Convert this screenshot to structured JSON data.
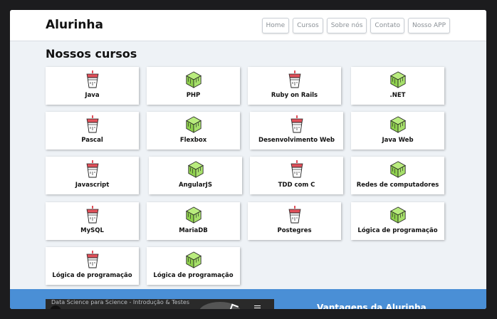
{
  "header": {
    "brand": "Alurinha",
    "nav": [
      {
        "label": "Home",
        "name": "nav-home"
      },
      {
        "label": "Cursos",
        "name": "nav-cursos"
      },
      {
        "label": "Sobre nós",
        "name": "nav-sobre-nos"
      },
      {
        "label": "Contato",
        "name": "nav-contato"
      },
      {
        "label": "Nosso APP",
        "name": "nav-nosso-app"
      }
    ]
  },
  "main": {
    "title": "Nossos cursos",
    "courses": [
      {
        "label": "Java",
        "icon": "coffee-cup-icon"
      },
      {
        "label": "PHP",
        "icon": "green-cube-icon"
      },
      {
        "label": "Ruby on Rails",
        "icon": "coffee-cup-icon"
      },
      {
        "label": ".NET",
        "icon": "green-cube-icon"
      },
      {
        "label": "Pascal",
        "icon": "coffee-cup-icon"
      },
      {
        "label": "Flexbox",
        "icon": "green-cube-icon"
      },
      {
        "label": "Desenvolvimento Web",
        "icon": "coffee-cup-icon"
      },
      {
        "label": "Java Web",
        "icon": "green-cube-icon"
      },
      {
        "label": "Javascript",
        "icon": "coffee-cup-icon"
      },
      {
        "label": "AngularJS",
        "icon": "green-cube-icon"
      },
      {
        "label": "TDD com C",
        "icon": "coffee-cup-icon"
      },
      {
        "label": "Redes de computadores",
        "icon": "green-cube-icon"
      },
      {
        "label": "MySQL",
        "icon": "coffee-cup-icon"
      },
      {
        "label": "MariaDB",
        "icon": "green-cube-icon"
      },
      {
        "label": "Postegres",
        "icon": "coffee-cup-icon"
      },
      {
        "label": "Lógica de programação",
        "icon": "green-cube-icon"
      },
      {
        "label": "Lógica de programação",
        "icon": "coffee-cup-icon"
      },
      {
        "label": "Lógica de programação",
        "icon": "green-cube-icon"
      }
    ]
  },
  "footer": {
    "video_title": "Data Science para Science - Introdução & Testes",
    "video_avatar": "a",
    "heading": "Vantagens da Alurinha"
  },
  "colors": {
    "accent_blue": "#4a8fd6",
    "cube_green": "#a6e06a",
    "cup_red": "#e0505a"
  }
}
